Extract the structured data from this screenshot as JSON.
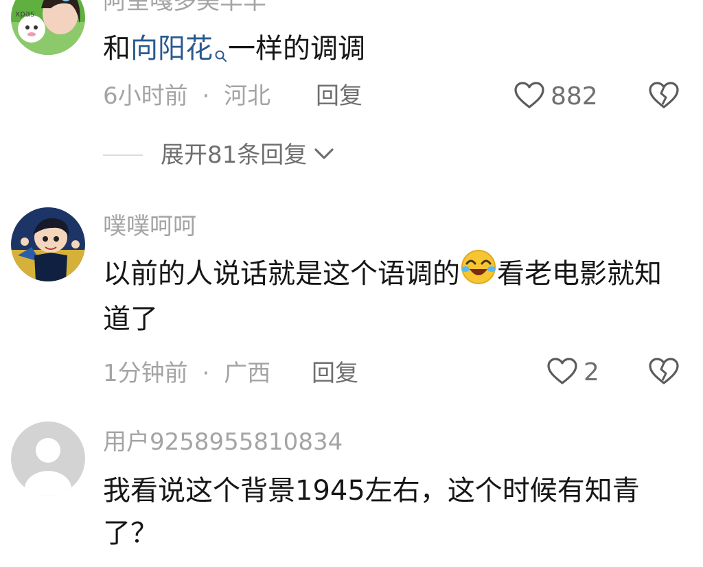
{
  "comments": [
    {
      "username": "阿呈嘎多美羊羊",
      "text_before": "和",
      "link_text": "向阳花",
      "text_after": "一样的调调",
      "time": "6小时前",
      "separator": "·",
      "location": "河北",
      "reply_label": "回复",
      "like_count": "882",
      "expand_label": "展开81条回复"
    },
    {
      "username": "噗噗呵呵",
      "text_before": "以前的人说话就是这个语调的",
      "emoji": "laughing-crying-emoji",
      "text_after": "看老电影就知道了",
      "time": "1分钟前",
      "separator": "·",
      "location": "广西",
      "reply_label": "回复",
      "like_count": "2"
    },
    {
      "username": "用户9258955810834",
      "text": "我看说这个背景1945左右，这个时候有知青了？"
    }
  ],
  "colors": {
    "text": "#161616",
    "meta": "#a4a4a4",
    "action": "#6f6f6f",
    "link": "#2a5a8f"
  }
}
